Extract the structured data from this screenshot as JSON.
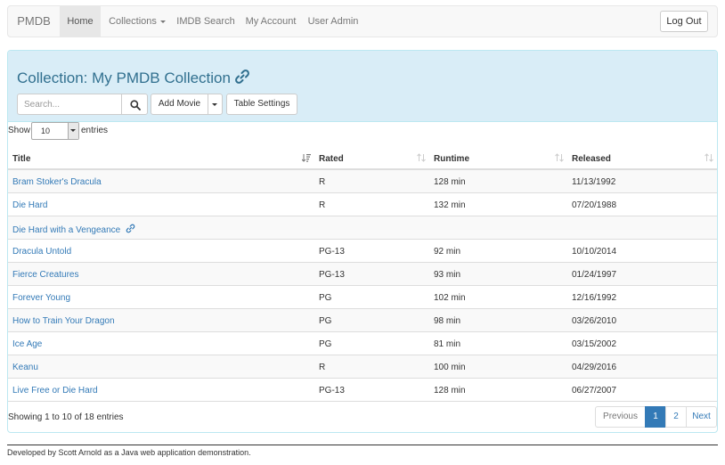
{
  "navbar": {
    "brand": "PMDB",
    "items": [
      {
        "label": "Home"
      },
      {
        "label": "Collections"
      },
      {
        "label": "IMDB Search"
      },
      {
        "label": "My Account"
      },
      {
        "label": "User Admin"
      }
    ],
    "logout": "Log Out"
  },
  "panel": {
    "title": "Collection: My PMDB Collection",
    "search_placeholder": "Search...",
    "add_movie": "Add Movie",
    "table_settings": "Table Settings"
  },
  "entries": {
    "show": "Show",
    "selected": "10",
    "label": "entries"
  },
  "table": {
    "columns": [
      "Title",
      "Rated",
      "Runtime",
      "Released"
    ],
    "rows": [
      {
        "title": "Bram Stoker's Dracula",
        "rated": "R",
        "runtime": "128 min",
        "released": "11/13/1992"
      },
      {
        "title": "Die Hard",
        "rated": "R",
        "runtime": "132 min",
        "released": "07/20/1988"
      },
      {
        "title": "Die Hard with a Vengeance",
        "rated": "",
        "runtime": "",
        "released": ""
      },
      {
        "title": "Dracula Untold",
        "rated": "PG-13",
        "runtime": "92 min",
        "released": "10/10/2014"
      },
      {
        "title": "Fierce Creatures",
        "rated": "PG-13",
        "runtime": "93 min",
        "released": "01/24/1997"
      },
      {
        "title": "Forever Young",
        "rated": "PG",
        "runtime": "102 min",
        "released": "12/16/1992"
      },
      {
        "title": "How to Train Your Dragon",
        "rated": "PG",
        "runtime": "98 min",
        "released": "03/26/2010"
      },
      {
        "title": "Ice Age",
        "rated": "PG",
        "runtime": "81 min",
        "released": "03/15/2002"
      },
      {
        "title": "Keanu",
        "rated": "R",
        "runtime": "100 min",
        "released": "04/29/2016"
      },
      {
        "title": "Live Free or Die Hard",
        "rated": "PG-13",
        "runtime": "128 min",
        "released": "06/27/2007"
      }
    ]
  },
  "info": "Showing 1 to 10 of 18 entries",
  "pagination": {
    "previous": "Previous",
    "pages": [
      "1",
      "2"
    ],
    "next": "Next"
  },
  "footer": "Developed by Scott Arnold as a Java web application demonstration.",
  "colors": {
    "primary": "#337ab7",
    "panel_heading": "#d9edf7",
    "panel_title": "#31708f"
  },
  "icons": {
    "title_link": "link-icon",
    "search": "search-icon",
    "sort_active": "sort-ascending-icon",
    "sort_inactive": "sort-icon"
  }
}
